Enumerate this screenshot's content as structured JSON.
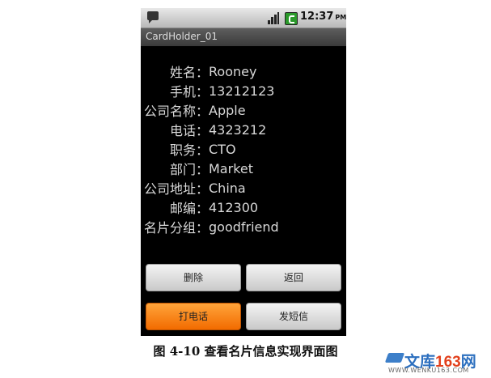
{
  "status_bar": {
    "time": "12:37",
    "ampm": "PM",
    "icons": [
      "sms-icon",
      "signal-icon",
      "battery-icon"
    ]
  },
  "app": {
    "title": "CardHolder_01"
  },
  "card_info": [
    {
      "label": "姓名：",
      "value": "Rooney"
    },
    {
      "label": "手机：",
      "value": "13212123"
    },
    {
      "label": "公司名称：",
      "value": "Apple"
    },
    {
      "label": "电话：",
      "value": "4323212"
    },
    {
      "label": "职务：",
      "value": "CTO"
    },
    {
      "label": "部门：",
      "value": "Market"
    },
    {
      "label": "公司地址：",
      "value": "China"
    },
    {
      "label": "邮编：",
      "value": "412300"
    },
    {
      "label": "名片分组：",
      "value": "goodfriend"
    }
  ],
  "buttons": {
    "delete": "删除",
    "back": "返回",
    "call": "打电话",
    "sms": "发短信"
  },
  "colors": {
    "screen_bg": "#000000",
    "accent_button": "#f57d14",
    "text": "#d8d8d8"
  },
  "caption": "图 4-10 查看名片信息实现界面图",
  "watermark": {
    "brand": "文库",
    "number": "163",
    "suffix": "网",
    "url": "WWW.WENKU163.COM"
  }
}
